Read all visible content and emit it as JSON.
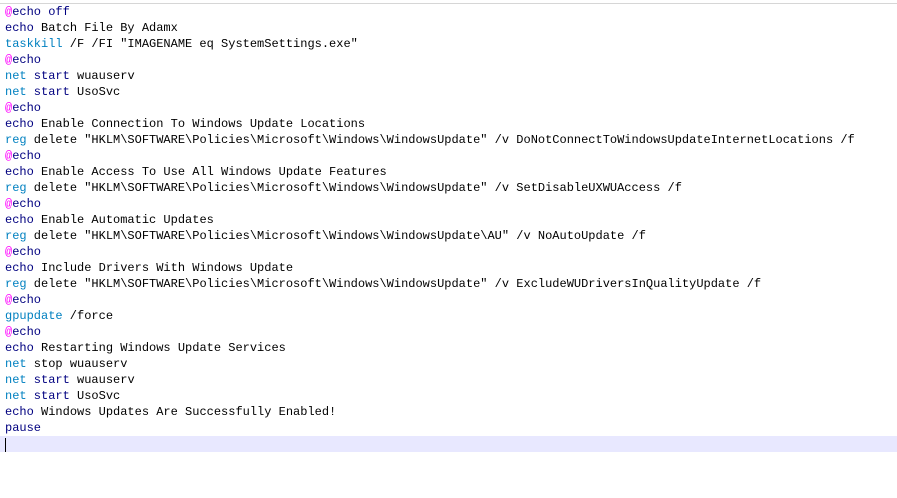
{
  "script_lines": [
    {
      "parts": [
        {
          "t": "@",
          "c": "at"
        },
        {
          "t": "echo off",
          "c": "kw-dark"
        }
      ]
    },
    {
      "parts": [
        {
          "t": "echo",
          "c": "kw-dark"
        },
        {
          "t": " Batch File By Adamx",
          "c": "plain"
        }
      ]
    },
    {
      "parts": [
        {
          "t": "taskkill",
          "c": "kw-cyan"
        },
        {
          "t": " /F /FI \"IMAGENAME eq SystemSettings.exe\"",
          "c": "plain"
        }
      ]
    },
    {
      "parts": [
        {
          "t": "@",
          "c": "at"
        },
        {
          "t": "echo",
          "c": "kw-dark"
        }
      ]
    },
    {
      "parts": [
        {
          "t": "net",
          "c": "kw-cyan"
        },
        {
          "t": " start",
          "c": "kw-dark"
        },
        {
          "t": " wuauserv",
          "c": "plain"
        }
      ]
    },
    {
      "parts": [
        {
          "t": "net",
          "c": "kw-cyan"
        },
        {
          "t": " start",
          "c": "kw-dark"
        },
        {
          "t": " UsoSvc",
          "c": "plain"
        }
      ]
    },
    {
      "parts": [
        {
          "t": "@",
          "c": "at"
        },
        {
          "t": "echo",
          "c": "kw-dark"
        }
      ]
    },
    {
      "parts": [
        {
          "t": "echo",
          "c": "kw-dark"
        },
        {
          "t": " Enable Connection To Windows Update Locations",
          "c": "plain"
        }
      ]
    },
    {
      "parts": [
        {
          "t": "reg",
          "c": "kw-cyan"
        },
        {
          "t": " delete \"HKLM\\SOFTWARE\\Policies\\Microsoft\\Windows\\WindowsUpdate\" /v DoNotConnectToWindowsUpdateInternetLocations /f",
          "c": "plain"
        }
      ]
    },
    {
      "parts": [
        {
          "t": "@",
          "c": "at"
        },
        {
          "t": "echo",
          "c": "kw-dark"
        }
      ]
    },
    {
      "parts": [
        {
          "t": "echo",
          "c": "kw-dark"
        },
        {
          "t": " Enable Access To Use All Windows Update Features",
          "c": "plain"
        }
      ]
    },
    {
      "parts": [
        {
          "t": "reg",
          "c": "kw-cyan"
        },
        {
          "t": " delete \"HKLM\\SOFTWARE\\Policies\\Microsoft\\Windows\\WindowsUpdate\" /v SetDisableUXWUAccess /f",
          "c": "plain"
        }
      ]
    },
    {
      "parts": [
        {
          "t": "@",
          "c": "at"
        },
        {
          "t": "echo",
          "c": "kw-dark"
        }
      ]
    },
    {
      "parts": [
        {
          "t": "echo",
          "c": "kw-dark"
        },
        {
          "t": " Enable Automatic Updates",
          "c": "plain"
        }
      ]
    },
    {
      "parts": [
        {
          "t": "reg",
          "c": "kw-cyan"
        },
        {
          "t": " delete \"HKLM\\SOFTWARE\\Policies\\Microsoft\\Windows\\WindowsUpdate\\AU\" /v NoAutoUpdate /f",
          "c": "plain"
        }
      ]
    },
    {
      "parts": [
        {
          "t": "@",
          "c": "at"
        },
        {
          "t": "echo",
          "c": "kw-dark"
        }
      ]
    },
    {
      "parts": [
        {
          "t": "echo",
          "c": "kw-dark"
        },
        {
          "t": " Include Drivers With Windows Update",
          "c": "plain"
        }
      ]
    },
    {
      "parts": [
        {
          "t": "reg",
          "c": "kw-cyan"
        },
        {
          "t": " delete \"HKLM\\SOFTWARE\\Policies\\Microsoft\\Windows\\WindowsUpdate\" /v ExcludeWUDriversInQualityUpdate /f",
          "c": "plain"
        }
      ]
    },
    {
      "parts": [
        {
          "t": "@",
          "c": "at"
        },
        {
          "t": "echo",
          "c": "kw-dark"
        }
      ]
    },
    {
      "parts": [
        {
          "t": "gpupdate",
          "c": "kw-cyan"
        },
        {
          "t": " /force",
          "c": "plain"
        }
      ]
    },
    {
      "parts": [
        {
          "t": "@",
          "c": "at"
        },
        {
          "t": "echo",
          "c": "kw-dark"
        }
      ]
    },
    {
      "parts": [
        {
          "t": "echo",
          "c": "kw-dark"
        },
        {
          "t": " Restarting Windows Update Services",
          "c": "plain"
        }
      ]
    },
    {
      "parts": [
        {
          "t": "net",
          "c": "kw-cyan"
        },
        {
          "t": " stop wuauserv",
          "c": "plain"
        }
      ]
    },
    {
      "parts": [
        {
          "t": "net",
          "c": "kw-cyan"
        },
        {
          "t": " start",
          "c": "kw-dark"
        },
        {
          "t": " wuauserv",
          "c": "plain"
        }
      ]
    },
    {
      "parts": [
        {
          "t": "net",
          "c": "kw-cyan"
        },
        {
          "t": " start",
          "c": "kw-dark"
        },
        {
          "t": " UsoSvc",
          "c": "plain"
        }
      ]
    },
    {
      "parts": [
        {
          "t": "echo",
          "c": "kw-dark"
        },
        {
          "t": " Windows Updates Are Successfully Enabled!",
          "c": "plain"
        }
      ]
    },
    {
      "parts": [
        {
          "t": "pause",
          "c": "kw-dark"
        }
      ]
    }
  ],
  "colors": {
    "at_symbol": "#ff00ff",
    "command": "#0080c0",
    "keyword": "#000080",
    "current_line": "#e8e8ff"
  }
}
